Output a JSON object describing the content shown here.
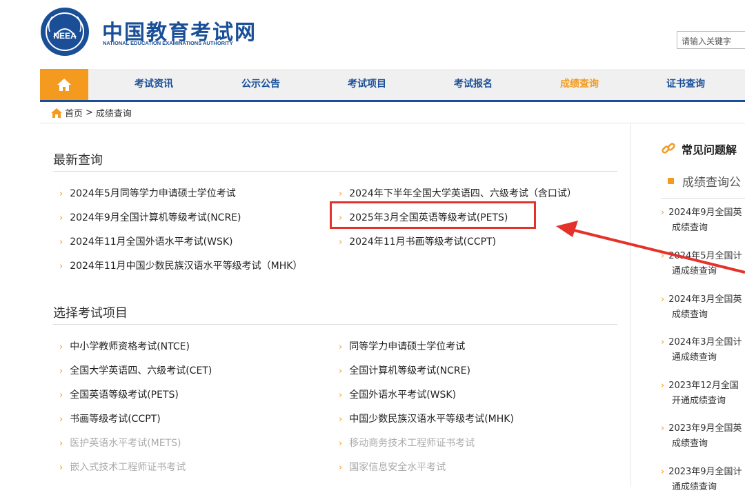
{
  "header": {
    "title_cn": "中国教育考试网",
    "title_en": "NATIONAL EDUCATION EXAMINATIONS AUTHORITY",
    "logo_text": "NEEA",
    "search_placeholder": "请输入关键字"
  },
  "nav": {
    "home_icon": "home-icon",
    "items": [
      "考试资讯",
      "公示公告",
      "考试项目",
      "考试报名",
      "成绩查询",
      "证书查询"
    ],
    "active": "成绩查询"
  },
  "breadcrumb": {
    "home": "首页",
    "sep": ">",
    "current": "成绩查询"
  },
  "latest": {
    "title": "最新查询",
    "left": [
      "2024年5月同等学力申请硕士学位考试",
      "2024年9月全国计算机等级考试(NCRE)",
      "2024年11月全国外语水平考试(WSK)",
      "2024年11月中国少数民族汉语水平等级考试（MHK）"
    ],
    "right": [
      "2024年下半年全国大学英语四、六级考试（含口试）",
      "2025年3月全国英语等级考试(PETS)",
      "2024年11月书画等级考试(CCPT)"
    ]
  },
  "projects": {
    "title": "选择考试项目",
    "left": [
      "中小学教师资格考试(NTCE)",
      "全国大学英语四、六级考试(CET)",
      "全国英语等级考试(PETS)",
      "书画等级考试(CCPT)",
      "医护英语水平考试(METS)",
      "嵌入式技术工程师证书考试"
    ],
    "right": [
      "同等学力申请硕士学位考试",
      "全国计算机等级考试(NCRE)",
      "全国外语水平考试(WSK)",
      "中国少数民族汉语水平等级考试(MHK)",
      "移动商务技术工程师证书考试",
      "国家信息安全水平考试"
    ]
  },
  "sidebar": {
    "title": "常见问题解",
    "subtitle": "成绩查询公",
    "items": [
      {
        "l1": "2024年9月全国英",
        "l2": "成绩查询"
      },
      {
        "l1": "2024年5月全国计",
        "l2": "通成绩查询"
      },
      {
        "l1": "2024年3月全国英",
        "l2": "成绩查询"
      },
      {
        "l1": "2024年3月全国计",
        "l2": "通成绩查询"
      },
      {
        "l1": "2023年12月全国",
        "l2": "开通成绩查询"
      },
      {
        "l1": "2023年9月全国英",
        "l2": "成绩查询"
      },
      {
        "l1": "2023年9月全国计",
        "l2": "通成绩查询"
      }
    ]
  },
  "colors": {
    "brand_blue": "#1a4f97",
    "accent_orange": "#f39a1f",
    "highlight_red": "#e4322b"
  }
}
